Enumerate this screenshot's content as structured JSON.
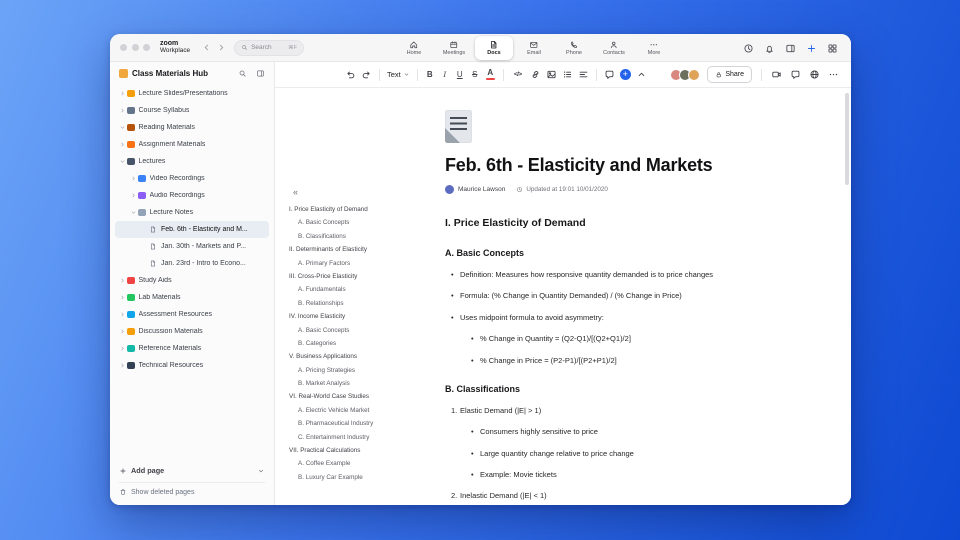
{
  "chrome": {
    "brand_line1": "zoom",
    "brand_line2": "Workplace",
    "search_placeholder": "Search",
    "search_shortcut": "⌘F",
    "nav_tabs": [
      {
        "label": "Home",
        "icon": "home",
        "active": false
      },
      {
        "label": "Meetings",
        "icon": "meetings",
        "active": false
      },
      {
        "label": "Docs",
        "icon": "docs",
        "active": true
      },
      {
        "label": "Email",
        "icon": "email",
        "active": false
      },
      {
        "label": "Phone",
        "icon": "phone",
        "active": false
      },
      {
        "label": "Contacts",
        "icon": "contacts",
        "active": false
      },
      {
        "label": "More",
        "icon": "more",
        "active": false
      }
    ],
    "titlebar_actions": [
      {
        "icon": "clock",
        "accent": false
      },
      {
        "icon": "bell",
        "accent": false
      },
      {
        "icon": "panel",
        "accent": false
      },
      {
        "icon": "plus",
        "accent": true
      },
      {
        "icon": "grid",
        "accent": false
      }
    ],
    "accent_color": "#2563eb"
  },
  "sidebar": {
    "title": "Class Materials Hub",
    "tree": [
      {
        "label": "Lecture Slides/Presentations",
        "depth": 0,
        "chevron": "right",
        "color": "#f59e0b",
        "selected": false
      },
      {
        "label": "Course Syllabus",
        "depth": 0,
        "chevron": "right",
        "color": "#64748b",
        "selected": false
      },
      {
        "label": "Reading Materials",
        "depth": 0,
        "chevron": "down",
        "color": "#b45309",
        "selected": false
      },
      {
        "label": "Assignment Materials",
        "depth": 0,
        "chevron": "right",
        "color": "#f97316",
        "selected": false
      },
      {
        "label": "Lectures",
        "depth": 0,
        "chevron": "down",
        "color": "#475569",
        "selected": false
      },
      {
        "label": "Video Recordings",
        "depth": 1,
        "chevron": "right",
        "color": "#3b82f6",
        "selected": false
      },
      {
        "label": "Audio Recordings",
        "depth": 1,
        "chevron": "right",
        "color": "#8b5cf6",
        "selected": false
      },
      {
        "label": "Lecture Notes",
        "depth": 1,
        "chevron": "down",
        "color": "#94a3b8",
        "selected": false
      },
      {
        "label": "Feb. 6th - Elasticity and M...",
        "depth": 2,
        "chevron": "none",
        "icon": "page",
        "selected": true
      },
      {
        "label": "Jan. 30th - Markets and P...",
        "depth": 2,
        "chevron": "none",
        "icon": "page",
        "selected": false
      },
      {
        "label": "Jan. 23rd - Intro to Econo...",
        "depth": 2,
        "chevron": "none",
        "icon": "page",
        "selected": false
      },
      {
        "label": "Study Aids",
        "depth": 0,
        "chevron": "right",
        "color": "#ef4444",
        "selected": false
      },
      {
        "label": "Lab Materials",
        "depth": 0,
        "chevron": "right",
        "color": "#22c55e",
        "selected": false
      },
      {
        "label": "Assessment Resources",
        "depth": 0,
        "chevron": "right",
        "color": "#0ea5e9",
        "selected": false
      },
      {
        "label": "Discussion Materials",
        "depth": 0,
        "chevron": "right",
        "color": "#f59e0b",
        "selected": false
      },
      {
        "label": "Reference Materials",
        "depth": 0,
        "chevron": "right",
        "color": "#14b8a6",
        "selected": false
      },
      {
        "label": "Technical Resources",
        "depth": 0,
        "chevron": "right",
        "color": "#334155",
        "selected": false
      }
    ],
    "add_page_label": "Add page",
    "show_deleted_label": "Show deleted pages"
  },
  "toolbar": {
    "text_style_label": "Text",
    "share_label": "Share",
    "font_color_swatch": "#ef4444",
    "avatar_colors": [
      "#d98880",
      "#6b705c",
      "#e0a458"
    ],
    "left_items": [
      {
        "t": "icon",
        "name": "undo"
      },
      {
        "t": "icon",
        "name": "redo"
      },
      {
        "t": "div"
      },
      {
        "t": "textstyle",
        "name": "text-style"
      },
      {
        "t": "div"
      },
      {
        "t": "glyph",
        "name": "bold",
        "glyph": "B",
        "cls": "g-bold"
      },
      {
        "t": "glyph",
        "name": "italic",
        "glyph": "I",
        "cls": "g-italic"
      },
      {
        "t": "glyph",
        "name": "underline",
        "glyph": "U",
        "cls": "g-underline"
      },
      {
        "t": "glyph",
        "name": "strikethrough",
        "glyph": "S",
        "cls": "g-strike"
      },
      {
        "t": "fontcolor",
        "name": "font-color",
        "glyph": "A"
      },
      {
        "t": "div"
      },
      {
        "t": "glyph",
        "name": "code",
        "glyph": "</>",
        "cls": "g-code"
      },
      {
        "t": "icon",
        "name": "link"
      },
      {
        "t": "icon",
        "name": "image"
      },
      {
        "t": "icon",
        "name": "bullet-list"
      },
      {
        "t": "icon",
        "name": "align"
      },
      {
        "t": "div"
      },
      {
        "t": "icon",
        "name": "comment"
      },
      {
        "t": "pluscircle",
        "name": "insert"
      },
      {
        "t": "icon",
        "name": "chevron-up"
      }
    ],
    "right_items": [
      "camera",
      "chat",
      "globe",
      "more"
    ]
  },
  "document": {
    "title": "Feb. 6th - Elasticity and Markets",
    "author": "Maurice Lawson",
    "updated_text": "Updated at 19:01 10/01/2020",
    "toc_collapse_glyph": "«",
    "toc": [
      {
        "text": "I. Price Elasticity of Demand",
        "level": 0
      },
      {
        "text": "A. Basic Concepts",
        "level": 1
      },
      {
        "text": "B. Classifications",
        "level": 1
      },
      {
        "text": "II. Determinants of Elasticity",
        "level": 0
      },
      {
        "text": "A. Primary Factors",
        "level": 1
      },
      {
        "text": "III. Cross-Price Elasticity",
        "level": 0
      },
      {
        "text": "A. Fundamentals",
        "level": 1
      },
      {
        "text": "B. Relationships",
        "level": 1
      },
      {
        "text": "IV. Income Elasticity",
        "level": 0
      },
      {
        "text": "A. Basic Concepts",
        "level": 1
      },
      {
        "text": "B. Categories",
        "level": 1
      },
      {
        "text": "V. Business Applications",
        "level": 0
      },
      {
        "text": "A. Pricing Strategies",
        "level": 1
      },
      {
        "text": "B. Market Analysis",
        "level": 1
      },
      {
        "text": "VI. Real-World Case Studies",
        "level": 0
      },
      {
        "text": "A. Electric Vehicle Market",
        "level": 1
      },
      {
        "text": "B. Pharmaceutical Industry",
        "level": 1
      },
      {
        "text": "C. Entertainment Industry",
        "level": 1
      },
      {
        "text": "VII. Practical Calculations",
        "level": 0
      },
      {
        "text": "A. Coffee Example",
        "level": 1
      },
      {
        "text": "B. Luxury Car Example",
        "level": 1
      }
    ],
    "body": [
      {
        "type": "h2",
        "text": "I. Price Elasticity of Demand"
      },
      {
        "type": "h3",
        "text": "A. Basic Concepts"
      },
      {
        "type": "li",
        "level": 1,
        "marker": "•",
        "text": "Definition: Measures how responsive quantity demanded is to price changes"
      },
      {
        "type": "li",
        "level": 1,
        "marker": "•",
        "text": "Formula: (% Change in Quantity Demanded) / (% Change in Price)"
      },
      {
        "type": "li",
        "level": 1,
        "marker": "•",
        "text": "Uses midpoint formula to avoid asymmetry:"
      },
      {
        "type": "li",
        "level": 2,
        "marker": "•",
        "text": "% Change in Quantity = (Q2-Q1)/[(Q2+Q1)/2]"
      },
      {
        "type": "li",
        "level": 2,
        "marker": "•",
        "text": "% Change in Price = (P2-P1)/[(P2+P1)/2]"
      },
      {
        "type": "h3",
        "text": "B. Classifications"
      },
      {
        "type": "li",
        "level": 1,
        "marker": "1.",
        "text": "Elastic Demand (|E| > 1)"
      },
      {
        "type": "li",
        "level": 2,
        "marker": "•",
        "text": "Consumers highly sensitive to price"
      },
      {
        "type": "li",
        "level": 2,
        "marker": "•",
        "text": "Large quantity change relative to price change"
      },
      {
        "type": "li",
        "level": 2,
        "marker": "•",
        "text": "Example: Movie tickets"
      },
      {
        "type": "li",
        "level": 1,
        "marker": "2.",
        "text": "Inelastic Demand (|E| < 1)"
      }
    ]
  }
}
